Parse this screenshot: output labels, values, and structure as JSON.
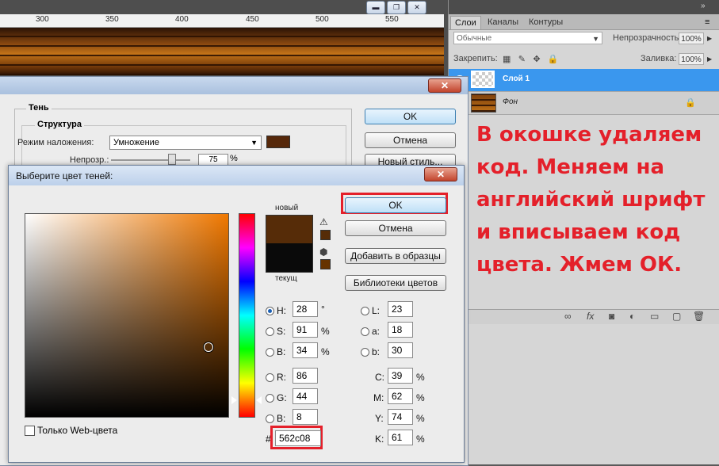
{
  "ruler": {
    "ticks": [
      "300",
      "350",
      "400",
      "450",
      "500",
      "550"
    ]
  },
  "layers_panel": {
    "tabs": [
      "Слои",
      "Каналы",
      "Контуры"
    ],
    "blend_mode": "Обычные",
    "opacity_label": "Непрозрачность:",
    "opacity_value": "100%",
    "lock_label": "Закрепить:",
    "fill_label": "Заливка:",
    "fill_value": "100%",
    "layers": [
      {
        "name": "Слой 1",
        "selected": true
      },
      {
        "name": "Фон",
        "selected": false
      }
    ],
    "bottom_icons": [
      "link-icon",
      "fx-icon",
      "mask-icon",
      "adjustment-icon",
      "group-icon",
      "new-layer-icon",
      "trash-icon"
    ]
  },
  "annotation": "В окошке удаляем код. Меняем на английский шрифт и вписываем код цвета. Жмем ОК.",
  "layer_style_dialog": {
    "group_title": "Тень",
    "structure_title": "Структура",
    "blend_label": "Режим наложения:",
    "blend_value": "Умножение",
    "opacity_label": "Непрозр.:",
    "opacity_value": "75",
    "opacity_unit": "%",
    "ok": "OK",
    "cancel": "Отмена",
    "new_style": "Новый стиль...",
    "shadow_color": "#56280a"
  },
  "color_picker": {
    "title": "Выберите цвет теней:",
    "new_label": "новый",
    "current_label": "текущ",
    "new_color": "#562c08",
    "current_color": "#0a0a0a",
    "buttons": {
      "ok": "OK",
      "cancel": "Отмена",
      "add_swatch": "Добавить в образцы",
      "libraries": "Библиотеки цветов"
    },
    "fields_left": [
      {
        "label": "H:",
        "value": "28",
        "unit": "°",
        "selected": true
      },
      {
        "label": "S:",
        "value": "91",
        "unit": "%",
        "selected": false
      },
      {
        "label": "B:",
        "value": "34",
        "unit": "%",
        "selected": false
      },
      {
        "label": "R:",
        "value": "86",
        "unit": "",
        "selected": false
      },
      {
        "label": "G:",
        "value": "44",
        "unit": "",
        "selected": false
      },
      {
        "label": "B:",
        "value": "8",
        "unit": "",
        "selected": false
      }
    ],
    "fields_lab": [
      {
        "label": "L:",
        "value": "23"
      },
      {
        "label": "a:",
        "value": "18"
      },
      {
        "label": "b:",
        "value": "30"
      }
    ],
    "fields_cmyk": [
      {
        "label": "C:",
        "value": "39",
        "unit": "%"
      },
      {
        "label": "M:",
        "value": "62",
        "unit": "%"
      },
      {
        "label": "Y:",
        "value": "74",
        "unit": "%"
      },
      {
        "label": "K:",
        "value": "61",
        "unit": "%"
      }
    ],
    "hex_prefix": "#",
    "hex_value": "562c08",
    "web_only_label": "Только Web-цвета"
  }
}
